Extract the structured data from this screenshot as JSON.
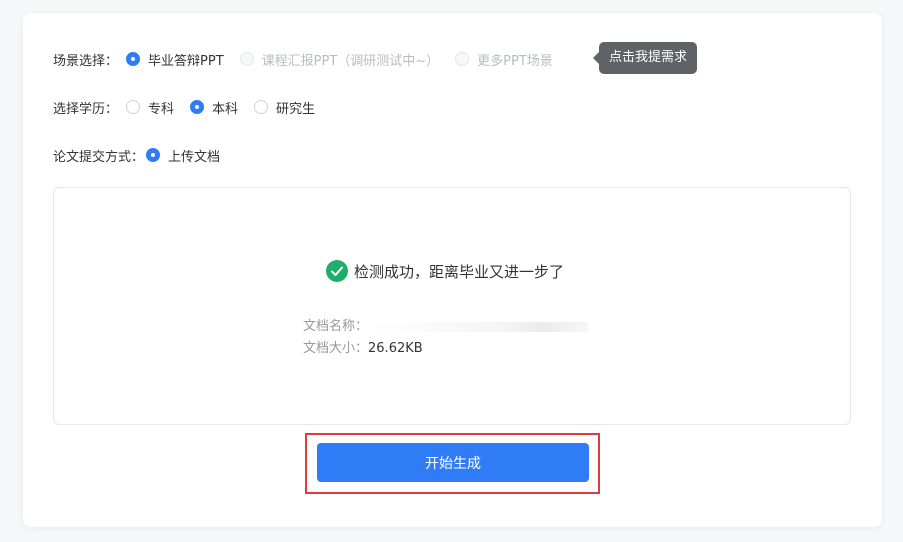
{
  "scene": {
    "label": "场景选择：",
    "options": [
      {
        "label": "毕业答辩PPT",
        "checked": true,
        "disabled": false
      },
      {
        "label": "课程汇报PPT（调研测试中~）",
        "checked": false,
        "disabled": true
      },
      {
        "label": "更多PPT场景",
        "checked": false,
        "disabled": true
      }
    ],
    "tooltip": "点击我提需求"
  },
  "education": {
    "label": "选择学历：",
    "options": [
      {
        "label": "专科",
        "checked": false
      },
      {
        "label": "本科",
        "checked": true
      },
      {
        "label": "研究生",
        "checked": false
      }
    ]
  },
  "submit_method": {
    "label": "论文提交方式：",
    "options": [
      {
        "label": "上传文档",
        "checked": true
      }
    ]
  },
  "upload": {
    "success_text": "检测成功，距离毕业又进一步了",
    "file_name_label": "文档名称：",
    "file_size_label": "文档大小：",
    "file_size": "26.62KB"
  },
  "colors": {
    "accent": "#2f7cf6",
    "success": "#1fae69",
    "highlight": "#e0393e",
    "tooltip_bg": "#606266"
  },
  "actions": {
    "start_label": "开始生成"
  }
}
